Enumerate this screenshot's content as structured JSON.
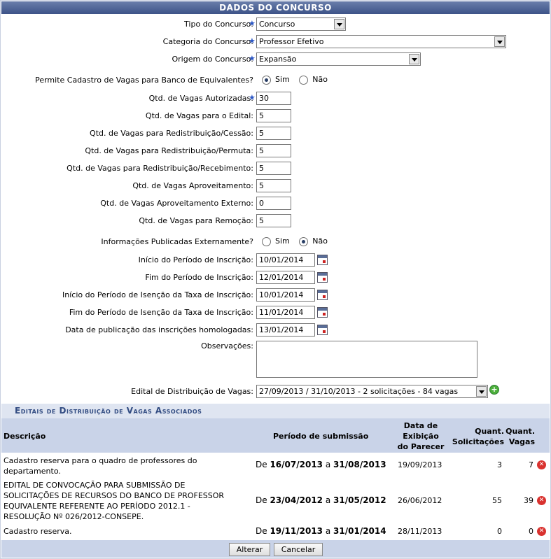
{
  "header": {
    "title": "Dados do Concurso"
  },
  "form": {
    "tipo": {
      "label": "Tipo do Concurso:",
      "value": "Concurso"
    },
    "categoria": {
      "label": "Categoria do Concurso:",
      "value": "Professor Efetivo"
    },
    "origem": {
      "label": "Origem do Concurso:",
      "value": "Expansão"
    },
    "banco": {
      "label": "Permite Cadastro de Vagas para Banco de Equivalentes?",
      "opt_sim": "Sim",
      "opt_nao": "Não",
      "selected": "Sim"
    },
    "autorizadas": {
      "label": "Qtd. de Vagas Autorizadas:",
      "value": "30"
    },
    "edital": {
      "label": "Qtd. de Vagas para o Edital:",
      "value": "5"
    },
    "cessao": {
      "label": "Qtd. de Vagas para Redistribuição/Cessão:",
      "value": "5"
    },
    "permuta": {
      "label": "Qtd. de Vagas para Redistribuição/Permuta:",
      "value": "5"
    },
    "recebimento": {
      "label": "Qtd. de Vagas para Redistribuição/Recebimento:",
      "value": "5"
    },
    "aproveitamento": {
      "label": "Qtd. de Vagas Aproveitamento:",
      "value": "5"
    },
    "aprov_externo": {
      "label": "Qtd. de Vagas Aproveitamento Externo:",
      "value": "0"
    },
    "remocao": {
      "label": "Qtd. de Vagas para Remoção:",
      "value": "5"
    },
    "publicadas": {
      "label": "Informações Publicadas Externamente?",
      "opt_sim": "Sim",
      "opt_nao": "Não",
      "selected": "Não"
    },
    "inicio_inscricao": {
      "label": "Início do Período de Inscrição:",
      "value": "10/01/2014"
    },
    "fim_inscricao": {
      "label": "Fim do Período de Inscrição:",
      "value": "12/01/2014"
    },
    "inicio_isencao": {
      "label": "Início do Período de Isenção da Taxa de Inscrição:",
      "value": "10/01/2014"
    },
    "fim_isencao": {
      "label": "Fim do Período de Isenção da Taxa de Inscrição:",
      "value": "11/01/2014"
    },
    "publicacao": {
      "label": "Data de publicação das inscrições homologadas:",
      "value": "13/01/2014"
    },
    "observacoes": {
      "label": "Observações:",
      "value": ""
    },
    "edital_distrib": {
      "label": "Edital de Distribuição de Vagas:",
      "value": "27/09/2013 / 31/10/2013 - 2 solicitações - 84 vagas"
    }
  },
  "associados": {
    "title": "Editais de Distribuição de Vagas Associados",
    "headers": {
      "descricao": "Descrição",
      "periodo": "Período de submissão",
      "exibicao": [
        "Data de",
        "Exibição",
        "do Parecer"
      ],
      "solicitacoes": [
        "Quant.",
        "Solicitações"
      ],
      "vagas": [
        "Quant.",
        "Vagas"
      ]
    },
    "rows": [
      {
        "descricao": [
          "Cadastro reserva para o quadro de professores do",
          "departamento."
        ],
        "de": "De",
        "inicio": "16/07/2013",
        "a": "a",
        "fim": "31/08/2013",
        "parecer": "19/09/2013",
        "solicitacoes": "3",
        "vagas": "7"
      },
      {
        "descricao": [
          "EDITAL DE CONVOCAÇÃO PARA SUBMISSÃO DE",
          "SOLICITAÇÕES DE RECURSOS DO BANCO DE PROFESSOR",
          "EQUIVALENTE REFERENTE AO PERÍODO 2012.1 -",
          "RESOLUÇÃO Nº 026/2012-CONSEPE."
        ],
        "de": "De",
        "inicio": "23/04/2012",
        "a": "a",
        "fim": "31/05/2012",
        "parecer": "26/06/2012",
        "solicitacoes": "55",
        "vagas": "39"
      },
      {
        "descricao": [
          "Cadastro reserva."
        ],
        "de": "De",
        "inicio": "19/11/2013",
        "a": "a",
        "fim": "31/01/2014",
        "parecer": "28/11/2013",
        "solicitacoes": "0",
        "vagas": "0"
      }
    ]
  },
  "buttons": {
    "alterar": "Alterar",
    "cancelar": "Cancelar"
  },
  "icons": {
    "required": "asterisk-icon",
    "calendar": "calendar-icon",
    "add": "plus-icon",
    "remove": "remove-icon"
  }
}
